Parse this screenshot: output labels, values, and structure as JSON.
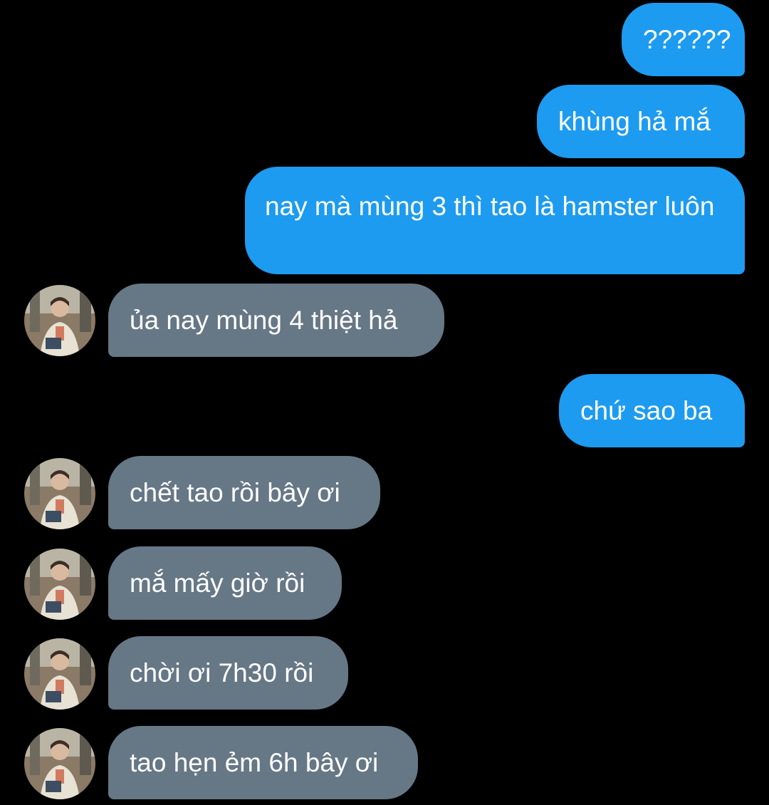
{
  "conversation": {
    "messages": [
      {
        "direction": "sent",
        "text": "??????"
      },
      {
        "direction": "sent",
        "text": "khùng hả mắ"
      },
      {
        "direction": "sent",
        "text": "nay mà mùng 3 thì tao là hamster luôn"
      },
      {
        "direction": "received",
        "text": "ủa nay mùng 4 thiệt hả",
        "avatar": "contact-avatar-photo"
      },
      {
        "direction": "sent",
        "text": "chứ sao ba"
      },
      {
        "direction": "received",
        "text": "chết tao rồi bây ơi",
        "avatar": "contact-avatar-photo"
      },
      {
        "direction": "received",
        "text": "mắ mấy giờ rồi",
        "avatar": "contact-avatar-photo"
      },
      {
        "direction": "received",
        "text": "chời ơi 7h30 rồi",
        "avatar": "contact-avatar-photo"
      },
      {
        "direction": "received",
        "text": "tao hẹn ẻm 6h bây ơi",
        "avatar": "contact-avatar-photo"
      }
    ]
  },
  "colors": {
    "background": "#000000",
    "sent_bubble": "#1d9bf0",
    "received_bubble": "#667786",
    "text": "#ffffff"
  }
}
